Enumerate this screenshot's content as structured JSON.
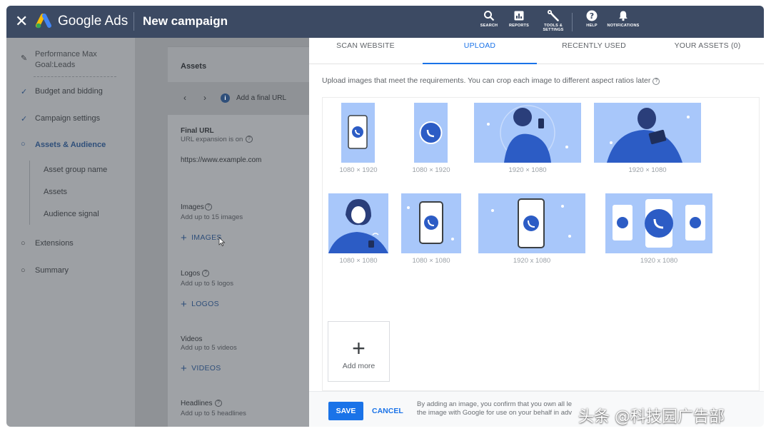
{
  "header": {
    "brand": "Google Ads",
    "title": "New campaign",
    "tools": [
      {
        "label": "SEARCH",
        "icon": "search-icon"
      },
      {
        "label": "REPORTS",
        "icon": "reports-icon"
      },
      {
        "label": "TOOLS &",
        "label2": "SETTINGS",
        "icon": "wrench-icon"
      },
      {
        "label": "HELP",
        "icon": "help-icon"
      },
      {
        "label": "NOTIFICATIONS",
        "icon": "bell-icon"
      }
    ]
  },
  "sidebar": {
    "goal_line1": "Performance Max",
    "goal_line2": "Goal:Leads",
    "steps": [
      {
        "label": "Budget and bidding",
        "status": "done"
      },
      {
        "label": "Campaign settings",
        "status": "done"
      },
      {
        "label": "Assets & Audience",
        "status": "current"
      }
    ],
    "substeps": [
      "Asset group name",
      "Assets",
      "Audience signal"
    ],
    "more_steps": [
      {
        "label": "Extensions",
        "status": "pending"
      },
      {
        "label": "Summary",
        "status": "pending"
      }
    ]
  },
  "main": {
    "section_title": "Assets",
    "url_prompt": "Add a final URL",
    "final_url_label": "Final URL",
    "final_url_note": "URL expansion is on",
    "final_url_value": "https://www.example.com",
    "images_label": "Images",
    "images_note": "Add up to 15 images",
    "images_link": "IMAGES",
    "logos_label": "Logos",
    "logos_note": "Add up to 5 logos",
    "logos_link": "LOGOS",
    "videos_label": "Videos",
    "videos_note": "Add up to 5 videos",
    "videos_link": "VIDEOS",
    "headlines_label": "Headlines",
    "headlines_note": "Add up to 5 headlines"
  },
  "panel": {
    "tabs": [
      "SCAN WEBSITE",
      "UPLOAD",
      "RECENTLY USED",
      "YOUR ASSETS (0)"
    ],
    "active_tab": "UPLOAD",
    "instructions": "Upload images that meet the requirements. You can crop each image to different aspect ratios later",
    "images": [
      {
        "size": "1080 × 1920",
        "subject": "phone-call"
      },
      {
        "size": "1080 × 1920",
        "subject": "call-badge"
      },
      {
        "size": "1920 × 1080",
        "subject": "woman-with-phone"
      },
      {
        "size": "1920 × 1080",
        "subject": "man-with-tablet"
      },
      {
        "size": "1080 × 1080",
        "subject": "woman-on-phone"
      },
      {
        "size": "1080 × 1080",
        "subject": "phone-call"
      },
      {
        "size": "1920 x 1080",
        "subject": "phone-call"
      },
      {
        "size": "1920 x 1080",
        "subject": "three-phones"
      }
    ],
    "add_more": "Add more",
    "save": "SAVE",
    "cancel": "CANCEL",
    "disclaimer_line1": "By adding an image, you confirm that you own all le",
    "disclaimer_line2": "the image with Google for use on your behalf in adv"
  },
  "watermark": "头条 @科技园广告部",
  "colors": {
    "topbar": "#3c4a63",
    "accent": "#1a73e8",
    "thumb_bg": "#a8c7fa",
    "thumb_dark": "#2c5cc5"
  }
}
